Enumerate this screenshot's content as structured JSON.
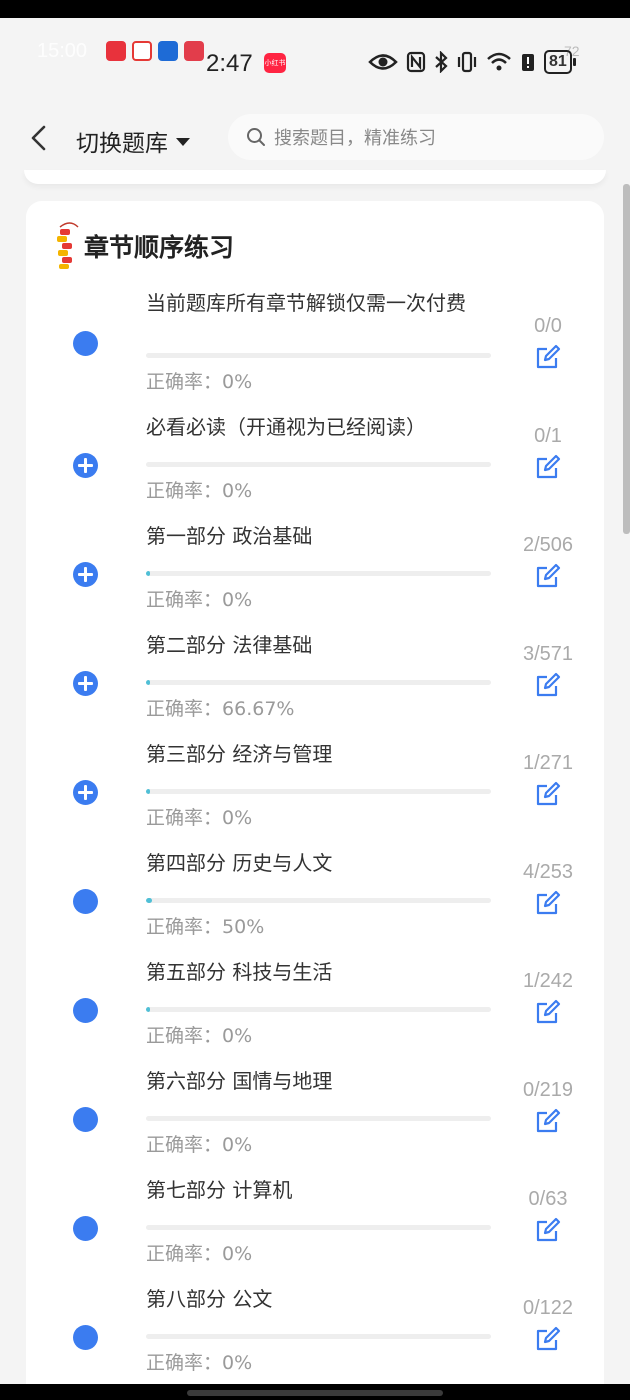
{
  "status_bar": {
    "ghost_time": "15:00",
    "ghost_battery": "72",
    "time": "2:47",
    "app_badge": "小红书",
    "battery": "81"
  },
  "header": {
    "switch_label": "切换题库",
    "search_placeholder": "搜索题目，精准练习"
  },
  "section": {
    "title": "章节顺序练习",
    "accuracy_prefix": "正确率：",
    "chapters": [
      {
        "title": "当前题库所有章节解锁仅需一次付费",
        "count": "0/0",
        "accuracy": "0%",
        "progress": 0,
        "expandable": false
      },
      {
        "title": "必看必读（开通视为已经阅读）",
        "count": "0/1",
        "accuracy": "0%",
        "progress": 0,
        "expandable": true
      },
      {
        "title": "第一部分 政治基础",
        "count": "2/506",
        "accuracy": "0%",
        "progress": 0.004,
        "expandable": true
      },
      {
        "title": "第二部分 法律基础",
        "count": "3/571",
        "accuracy": "66.67%",
        "progress": 0.005,
        "expandable": true
      },
      {
        "title": "第三部分 经济与管理",
        "count": "1/271",
        "accuracy": "0%",
        "progress": 0.004,
        "expandable": true
      },
      {
        "title": "第四部分 历史与人文",
        "count": "4/253",
        "accuracy": "50%",
        "progress": 0.016,
        "expandable": false
      },
      {
        "title": "第五部分 科技与生活",
        "count": "1/242",
        "accuracy": "0%",
        "progress": 0.004,
        "expandable": false
      },
      {
        "title": "第六部分 国情与地理",
        "count": "0/219",
        "accuracy": "0%",
        "progress": 0,
        "expandable": false
      },
      {
        "title": "第七部分 计算机",
        "count": "0/63",
        "accuracy": "0%",
        "progress": 0,
        "expandable": false
      },
      {
        "title": "第八部分 公文",
        "count": "0/122",
        "accuracy": "0%",
        "progress": 0,
        "expandable": false
      }
    ]
  },
  "colors": {
    "accent": "#3b7cf0",
    "progress": "#4fbfd6",
    "muted_text": "#9a9a9a",
    "count_text": "#aaaaaa"
  }
}
